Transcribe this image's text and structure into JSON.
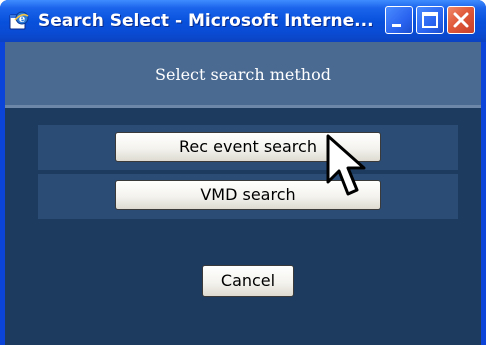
{
  "window": {
    "title": "Search Select - Microsoft Interne...",
    "accent_color": "#0a44d8",
    "controls": {
      "minimize_icon": "minimize-icon",
      "maximize_icon": "maximize-icon",
      "close_icon": "close-icon"
    }
  },
  "dialog": {
    "heading": "Select search method",
    "background_color": "#1c3b5f",
    "header_color": "#4a6a91",
    "buttons": {
      "rec_event_search": "Rec event search",
      "vmd_search": "VMD search",
      "cancel": "Cancel"
    }
  },
  "pointer": {
    "icon": "arrow-cursor-icon"
  }
}
